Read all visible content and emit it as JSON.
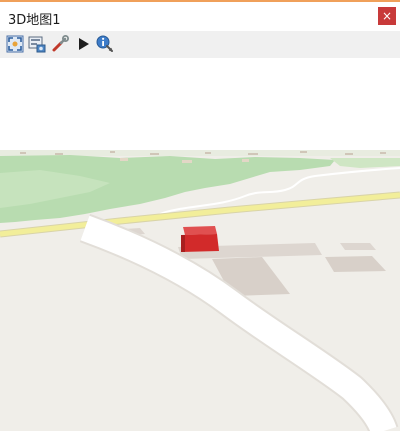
{
  "window": {
    "title": "3D地图1",
    "close_label": "×"
  },
  "toolbar": {
    "tools": [
      {
        "name": "zoom-full-icon"
      },
      {
        "name": "camera-settings-icon"
      },
      {
        "name": "configure-icon"
      },
      {
        "name": "play-animation-icon"
      },
      {
        "name": "identify-icon"
      }
    ]
  },
  "map": {
    "colors": {
      "sky": "#ffffff",
      "ground": "#f0eee9",
      "vegetation": "#b8dcb0",
      "road_major": "#f2ee9a",
      "road_minor": "#ffffff",
      "building_flat": "#ddd6d0",
      "building_3d": "#d22a2a"
    }
  }
}
